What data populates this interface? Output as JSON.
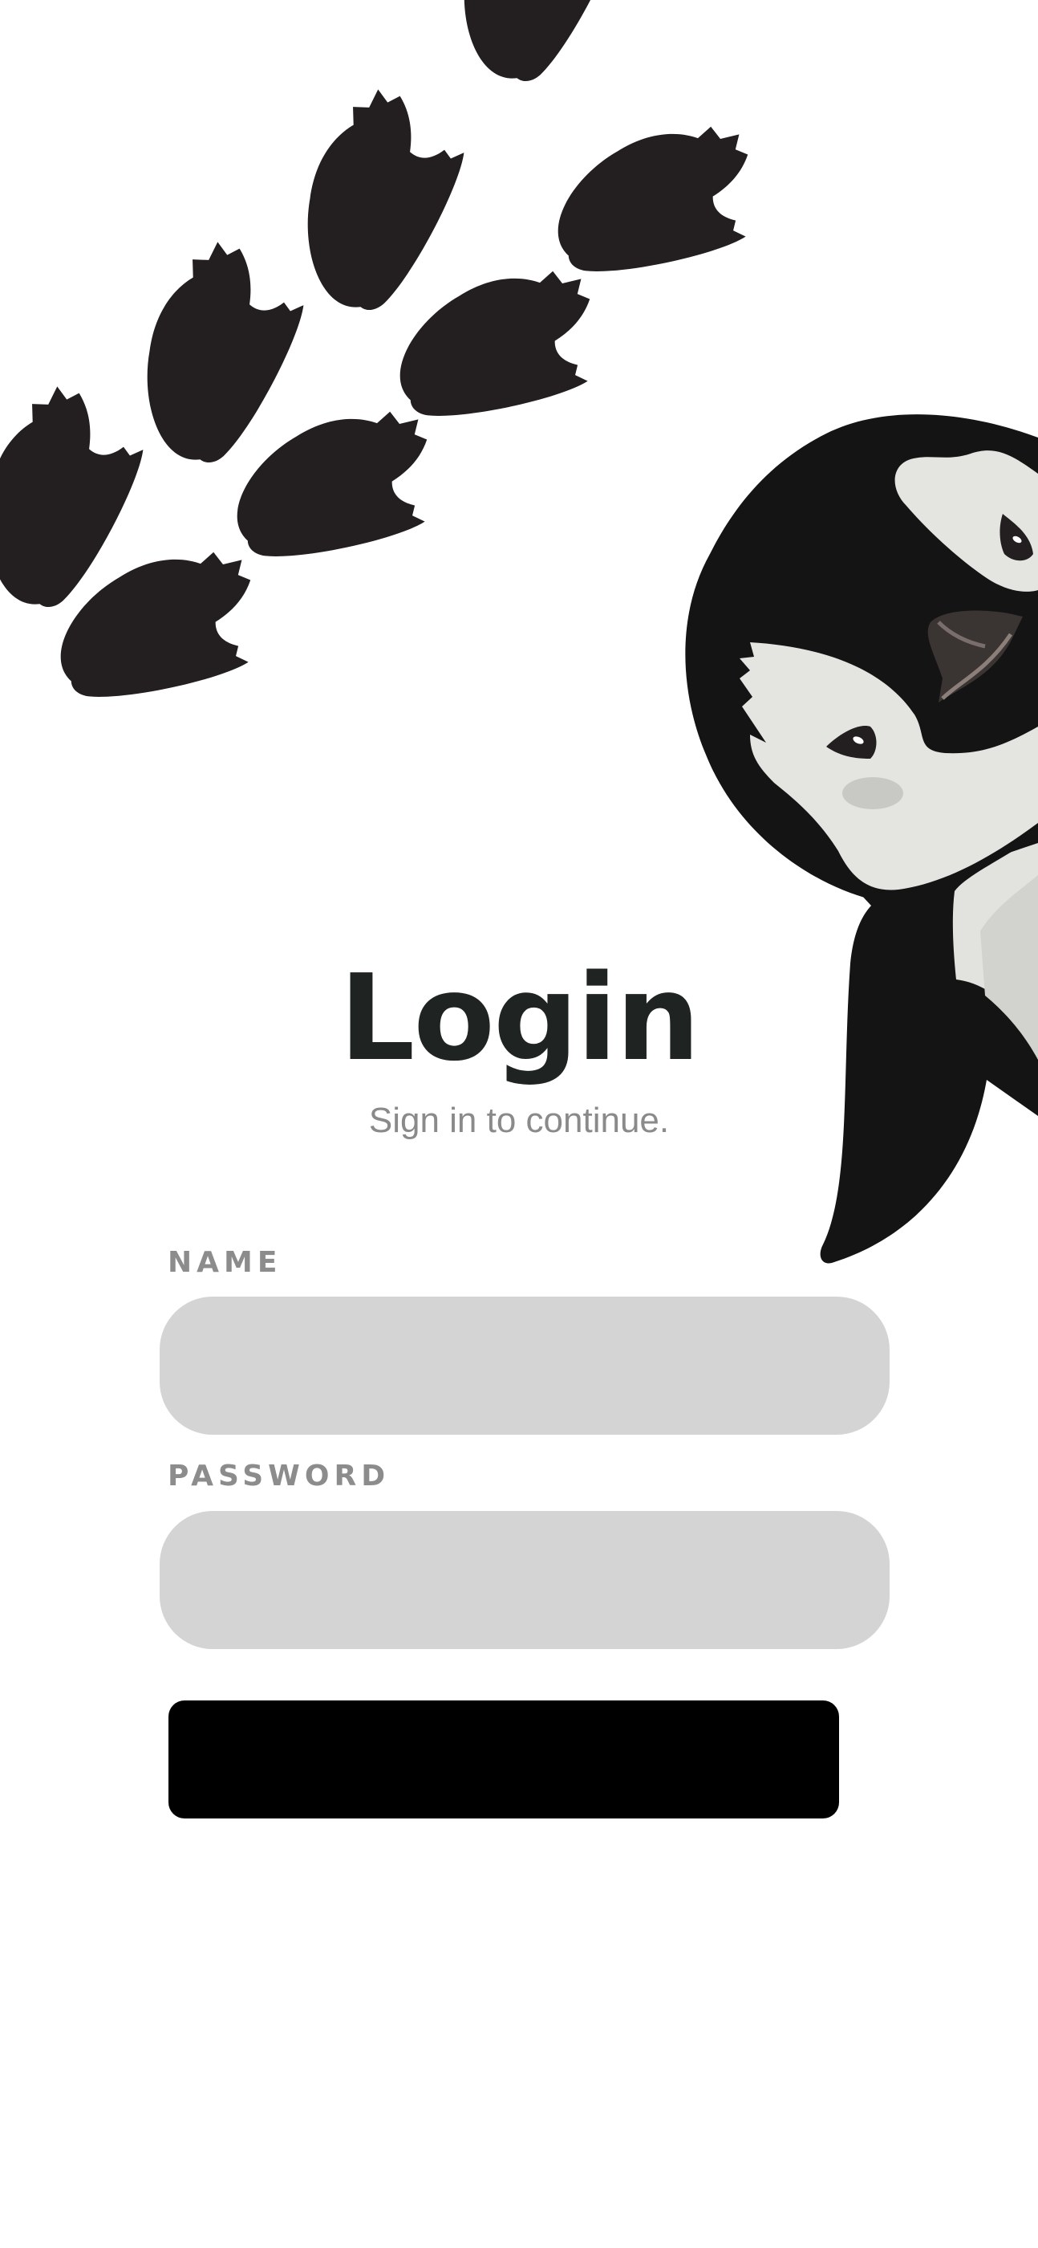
{
  "login": {
    "title": "Login",
    "subtitle": "Sign in to continue.",
    "name_label": "NAME",
    "name_value": "",
    "password_label": "PASSWORD",
    "password_value": "",
    "submit_label": ""
  },
  "illustration": {
    "footprints_icon": "penguin-footprints-icon",
    "mascot_icon": "penguin-mascot-icon"
  },
  "colors": {
    "background": "#ffffff",
    "ink": "#231f20",
    "title": "#1f2322",
    "subtitle": "#8a8a8a",
    "label": "#8c8c8c",
    "field": "#d4d4d4",
    "button": "#000000",
    "penguin_white": "#e4e5e1"
  }
}
